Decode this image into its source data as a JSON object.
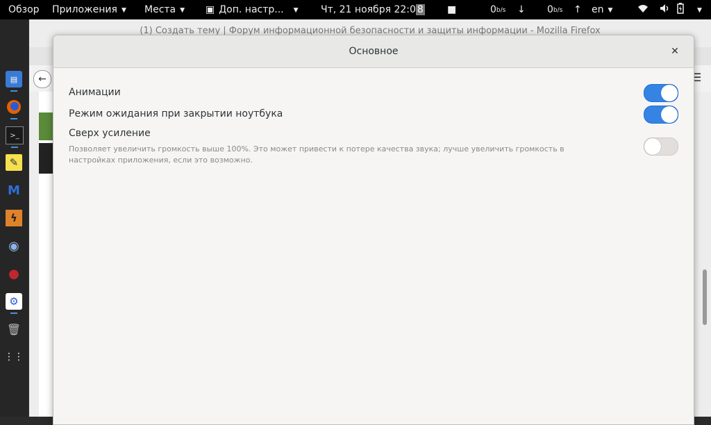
{
  "topbar": {
    "overview": "Обзор",
    "apps": "Приложения",
    "places": "Места",
    "active_app": "Доп. настр...",
    "date": "Чт, 21 ноября",
    "time_main": "22:0",
    "time_sel": "8",
    "net_down_value": "0",
    "net_down_unit": "b/s",
    "net_up_value": "0",
    "net_up_unit": "b/s",
    "lang": "en"
  },
  "firefox": {
    "window_title": "(1) Создать тему | Форум информационной безопасности и защиты информации - Mozilla Firefox"
  },
  "dialog": {
    "title": "Основное",
    "settings": [
      {
        "label": "Анимации",
        "enabled": true
      },
      {
        "label": "Режим ожидания при закрытии ноутбука",
        "enabled": true
      },
      {
        "label": "Сверх усиление",
        "description": "Позволяет увеличить громкость выше 100%. Это может привести к потере качества звука; лучше увеличить громкость в настройках приложения, если это возможно.",
        "enabled": false
      }
    ]
  },
  "colors": {
    "accent": "#3584e4",
    "switch_off": "#e1dedb"
  }
}
